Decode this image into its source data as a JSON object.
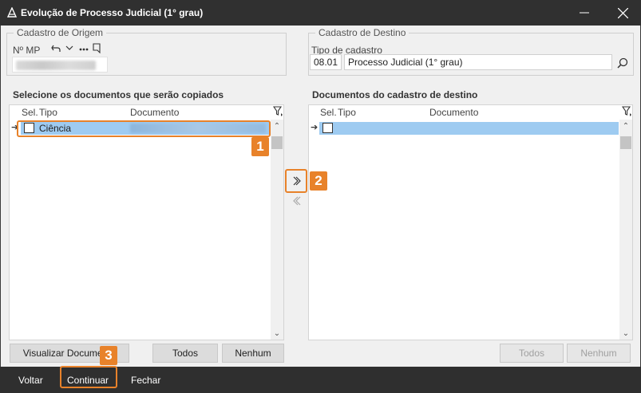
{
  "window": {
    "title": "Evolução de Processo Judicial (1° grau)"
  },
  "origem": {
    "legend": "Cadastro de Origem",
    "nmp_label": "Nº MP"
  },
  "destino": {
    "legend": "Cadastro de Destino",
    "tipo_label": "Tipo de cadastro",
    "tipo_code": "08.01",
    "tipo_name": "Processo Judicial (1° grau)"
  },
  "left_panel": {
    "title": "Selecione os documentos que serão copiados",
    "columns": [
      "Sel.",
      "Tipo",
      "Documento"
    ],
    "rows": [
      {
        "tipo": "Ciência"
      }
    ],
    "buttons": {
      "visualizar": "Visualizar Documento",
      "todos": "Todos",
      "nenhum": "Nenhum"
    }
  },
  "right_panel": {
    "title": "Documentos do cadastro de destino",
    "columns": [
      "Sel.",
      "Tipo",
      "Documento"
    ],
    "buttons": {
      "todos": "Todos",
      "nenhum": "Nenhum"
    }
  },
  "footer": {
    "voltar": "Voltar",
    "continuar": "Continuar",
    "fechar": "Fechar"
  },
  "callouts": [
    "1",
    "2",
    "3"
  ],
  "colors": {
    "accent": "#e8822a",
    "selection": "#9ecbf1",
    "titlebar": "#303030"
  }
}
